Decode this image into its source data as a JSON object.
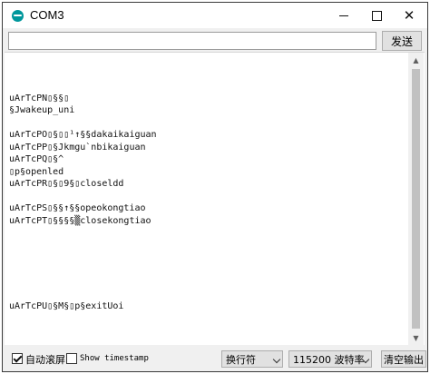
{
  "window": {
    "title": "COM3"
  },
  "toolbar": {
    "input_value": "",
    "send_label": "发送"
  },
  "console": {
    "lines": [
      "",
      "uArTcPN\u0000\u0000\u0000\u0000\u0000\u0000",
      "\u0000\u0000Jwakeup_uni",
      "",
      "uArTcPO\u0000\u0000\u0000\u0000\u0000\u0000\u0000\u0000\u0000\u0000dakaikaiguan",
      "uArTcPP\u0000\u0000\u0000\u0000Jkmgu`nbikaiguan",
      "uArTcPQ\u0000\u0000\u0000\u0000^",
      "\u0000p\u0000\u0000openled",
      "uArTcPR\u0000\u0000\u0000\u00009\u0000\u0000\u0000closeldd",
      "",
      "uArTcPS\u0000\u0000\u0000\u0000\u0000\u0000\u0000\u0000\u0000opeokongtiao",
      "uArTcPT\u0000\u0000\u0000\u0000\u0000\u0000\u0000\u0000closekongtiao",
      "",
      "",
      "",
      "",
      "",
      "",
      "uArTcPU\u0000\u0000\u0000M\u0000\u0000p\u0000\u0000exitUoi"
    ],
    "display_lines": [
      "",
      "uArTcPN▯§§▯",
      "§Jwakeup_uni",
      "",
      "uArTcPO▯§▯▯¹↑§§dakaikaiguan",
      "uArTcPP▯§Jkmgu`nbikaiguan",
      "uArTcPQ▯§^",
      "▯p§openled",
      "uArTcPR▯§▯9§▯closeldd",
      "",
      "uArTcPS▯§§↑§§opeokongtiao",
      "uArTcPT▯§§§§▒closekongtiao",
      "",
      "",
      "",
      "",
      "",
      "",
      "uArTcPU▯§M§▯p§exitUoi"
    ]
  },
  "status": {
    "autoscroll_label": "自动滚屏",
    "autoscroll_checked": true,
    "timestamp_label": "Show timestamp",
    "timestamp_checked": false,
    "line_ending": "换行符",
    "baud_rate": "115200 波特率",
    "clear_label": "清空输出"
  }
}
